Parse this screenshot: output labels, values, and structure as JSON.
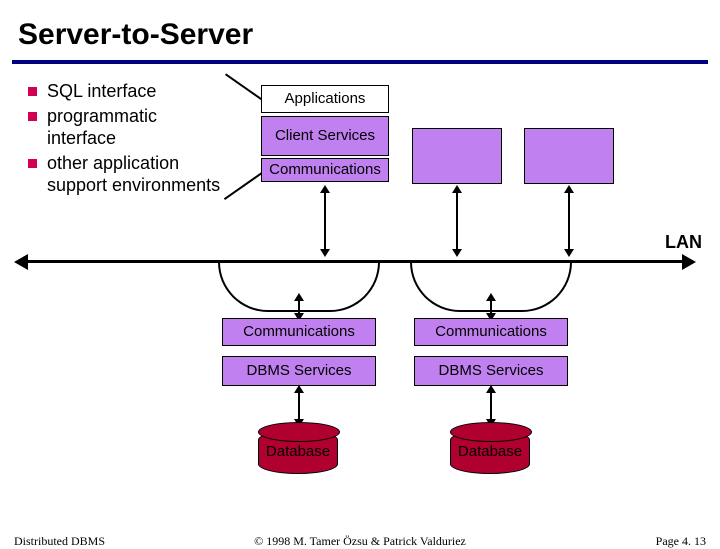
{
  "title": "Server-to-Server",
  "bullets": [
    "SQL interface",
    "programmatic interface",
    "other application support environments"
  ],
  "client_stack": {
    "applications": "Applications",
    "client_services": "Client Services",
    "communications": "Communications"
  },
  "lan_label": "LAN",
  "server": {
    "communications": "Communications",
    "dbms_services": "DBMS Services",
    "database": "Database"
  },
  "footer": {
    "left": "Distributed DBMS",
    "center": "© 1998 M. Tamer Özsu & Patrick Valduriez",
    "right": "Page 4. 13"
  }
}
